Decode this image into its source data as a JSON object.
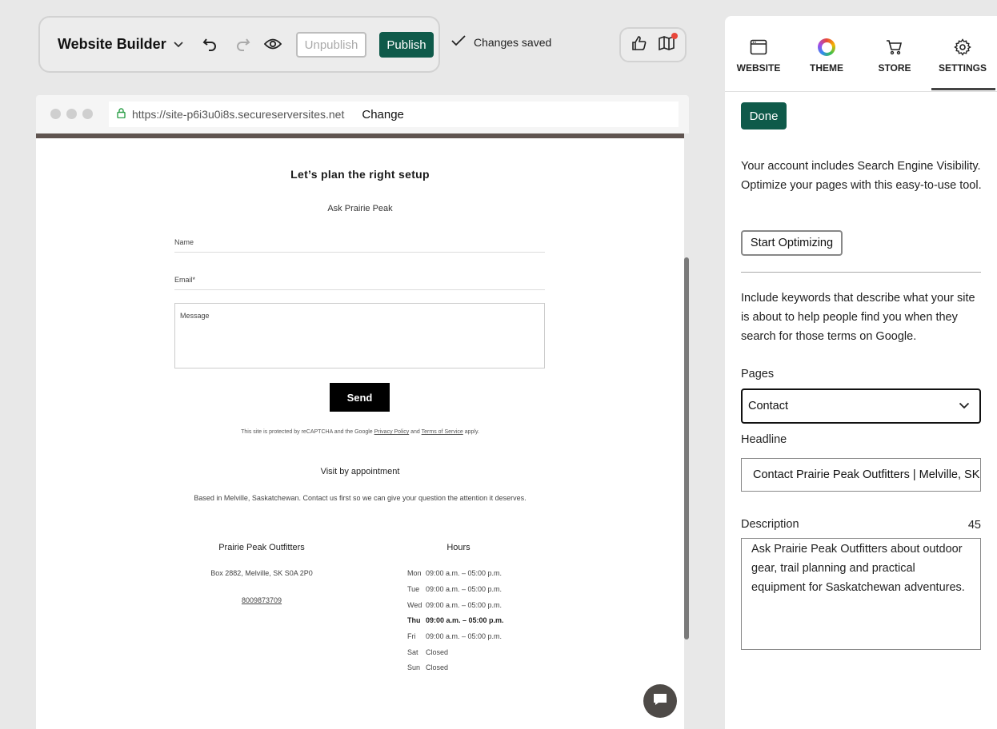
{
  "toolbar": {
    "brand": "Website Builder",
    "unpublish_label": "Unpublish",
    "publish_label": "Publish",
    "saved_text": "Changes saved"
  },
  "browser": {
    "url": "https://site-p6i3u0i8s.secureserversites.net",
    "change_label": "Change"
  },
  "site": {
    "title": "Let’s plan the right setup",
    "subtitle": "Ask Prairie Peak",
    "form": {
      "name_label": "Name",
      "email_label": "Email*",
      "message_label": "Message",
      "send_label": "Send"
    },
    "recaptcha": {
      "prefix": "This site is protected by reCAPTCHA and the Google ",
      "privacy": "Privacy Policy",
      "and": " and ",
      "terms": "Terms of Service",
      "suffix": " apply."
    },
    "visit_title": "Visit by appointment",
    "based_text": "Based in Melville, Saskatchewan. Contact us first so we can give your question the attention it deserves.",
    "business": {
      "name": "Prairie Peak Outfitters",
      "address": "Box 2882, Melville, SK S0A 2P0",
      "phone": "8009873709"
    },
    "hours": {
      "title": "Hours",
      "rows": [
        {
          "day": "Mon",
          "time": "09:00 a.m. – 05:00 p.m."
        },
        {
          "day": "Tue",
          "time": "09:00 a.m. – 05:00 p.m."
        },
        {
          "day": "Wed",
          "time": "09:00 a.m. – 05:00 p.m."
        },
        {
          "day": "Thu",
          "time": "09:00 a.m. – 05:00 p.m."
        },
        {
          "day": "Fri",
          "time": "09:00 a.m. – 05:00 p.m."
        },
        {
          "day": "Sat",
          "time": "Closed"
        },
        {
          "day": "Sun",
          "time": "Closed"
        }
      ]
    }
  },
  "panel": {
    "tabs": [
      {
        "label": "WEBSITE"
      },
      {
        "label": "THEME"
      },
      {
        "label": "STORE"
      },
      {
        "label": "SETTINGS"
      }
    ],
    "done_label": "Done",
    "seo_intro": "Your account includes Search Engine Visibility. Optimize your pages with this easy-to-use tool.",
    "start_label": "Start Optimizing",
    "keywords_text": "Include keywords that describe what your site is about to help people find you when they search for those terms on Google.",
    "pages_label": "Pages",
    "pages_value": "Contact",
    "headline_label": "Headline",
    "headline_value": "Contact Prairie Peak Outfitters | Melville, SK",
    "description_label": "Description",
    "description_count": "45",
    "description_value": "Ask Prairie Peak Outfitters about outdoor gear, trail planning and practical equipment for Saskatchewan adventures."
  },
  "colors": {
    "accent": "#0f5a4a",
    "notification": "#e8473b"
  }
}
